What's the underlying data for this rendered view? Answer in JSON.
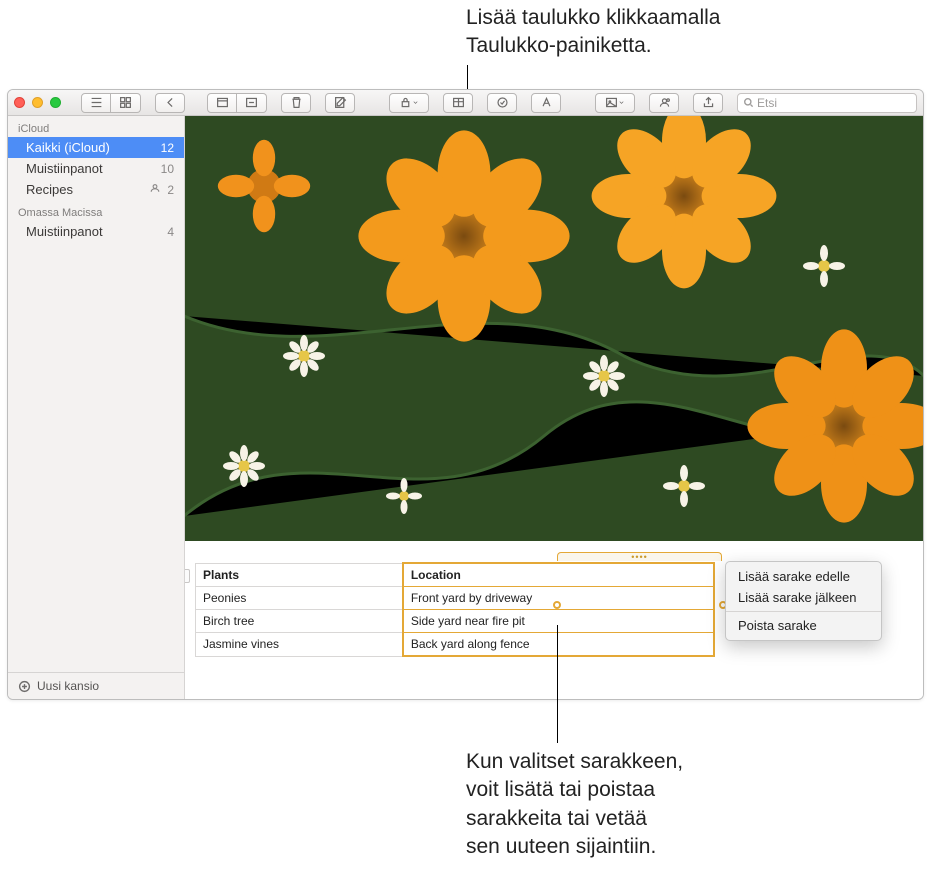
{
  "annotations": {
    "top": "Lisää taulukko klikkaamalla\nTaulukko-painiketta.",
    "bottom": "Kun valitset sarakkeen,\nvoit lisätä tai poistaa\nsarakkeita tai vetää\nsen uuteen sijaintiin."
  },
  "toolbar": {
    "search_placeholder": "Etsi"
  },
  "sidebar": {
    "sections": [
      {
        "header": "iCloud",
        "items": [
          {
            "label": "Kaikki (iCloud)",
            "count": "12",
            "selected": true
          },
          {
            "label": "Muistiinpanot",
            "count": "10"
          },
          {
            "label": "Recipes",
            "count": "2",
            "shared": true
          }
        ]
      },
      {
        "header": "Omassa Macissa",
        "items": [
          {
            "label": "Muistiinpanot",
            "count": "4"
          }
        ]
      }
    ],
    "footer": "Uusi kansio"
  },
  "table": {
    "headers": [
      "Plants",
      "Location"
    ],
    "rows": [
      [
        "Peonies",
        "Front yard by driveway"
      ],
      [
        "Birch tree",
        "Side yard near fire pit"
      ],
      [
        "Jasmine vines",
        "Back yard along fence"
      ]
    ]
  },
  "context_menu": {
    "items": [
      "Lisää sarake edelle",
      "Lisää sarake jälkeen"
    ],
    "items2": [
      "Poista sarake"
    ]
  }
}
